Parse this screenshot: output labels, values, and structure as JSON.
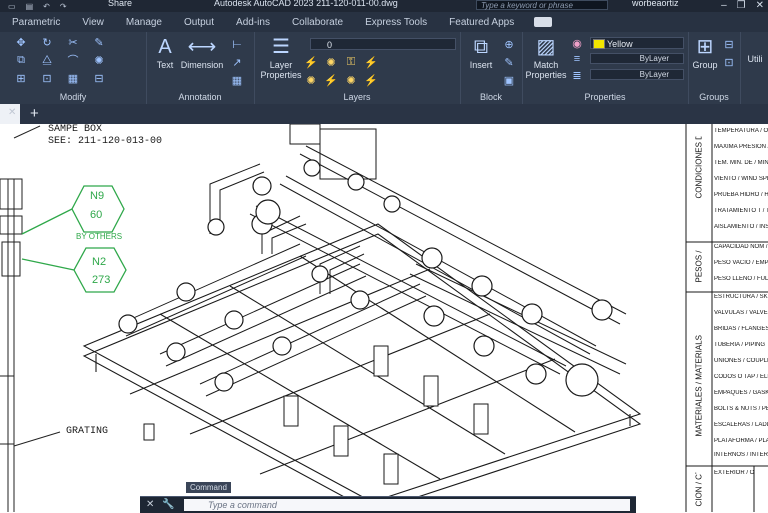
{
  "titlebar": {
    "share": "Share",
    "title": "Autodesk AutoCAD 2023    211-120-011-00.dwg",
    "search_placeholder": "Type a keyword or phrase",
    "user": "worbeaortiz"
  },
  "tabs": [
    "Parametric",
    "View",
    "Manage",
    "Output",
    "Add-ins",
    "Collaborate",
    "Express Tools",
    "Featured Apps"
  ],
  "ribbon": {
    "modify": "Modify",
    "annotation": "Annotation",
    "text": "Text",
    "dimension": "Dimension",
    "layer_properties": "Layer Properties",
    "layers": "Layers",
    "layer_value": "0",
    "insert": "Insert",
    "block": "Block",
    "match_properties": "Match Properties",
    "color_value": "Yellow",
    "linetype_value": "ByLayer",
    "lineweight_value": "ByLayer",
    "properties": "Properties",
    "group": "Group",
    "groups": "Groups",
    "utilities": "Utili"
  },
  "canvas": {
    "note_line1": "SAMPE BOX",
    "note_line2": "SEE: 211-120-013-00",
    "tag1_top": "N9",
    "tag1_bottom": "60",
    "by_others": "BY OTHERS",
    "tag2_top": "N2",
    "tag2_bottom": "273",
    "grating": "GRATING",
    "right_headers": [
      "CONDICIONES DE DISEÑO / DESING CONDITIONS",
      "PESOS / WEIGHT",
      "MATERIALES / MATERIALS",
      "CIÓN / CTION"
    ],
    "right_rows": [
      "TEMPERATURA / OPERATING TE",
      "MAXIMA PRESION / MAWP HOT &",
      "TEM. MIN. DE / MINIMUM DESI",
      "VIENTO / WIND SPEED",
      "PRUEBA HIDRO / HYDRAULIC TEST",
      "TRATAMIENTO T / THERMAL TREAT",
      "AISLAMIENTO / INSULATION",
      "CAPACIDAD NOM / NOMINAL CAPA",
      "PESO VACIO / EMPTY WEIGHT",
      "PESO LLENO / FULL WEIGHT",
      "ESTRUCTURA / SKID",
      "VALVULAS / VALVES",
      "BRIDAS / FLANGES",
      "TUBERIA / PIPING",
      "UNIONES / COUPLINGS",
      "CODOS O TAP / ELBOWS OR C",
      "EMPAQUES / GASKET",
      "BOLTS & NUTS / PERNOS",
      "ESCALERAS / LADDERS",
      "PLATAFORMA / PLATFORM",
      "INTERNOS / INTERNAL",
      "EXTERIOR / OUTSIDE"
    ]
  },
  "command": {
    "label": "Command",
    "placeholder": "Type a command"
  }
}
